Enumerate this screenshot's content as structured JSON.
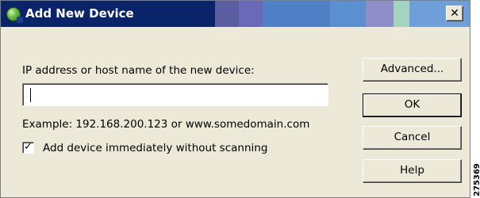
{
  "dialog": {
    "title": "Add New Device",
    "close_glyph": "✕",
    "icon": "device-globe-icon"
  },
  "form": {
    "ip_label": "IP address or host name of the new device:",
    "ip_value": "",
    "example": "Example: 192.168.200.123 or www.somedomain.com",
    "checkbox_label": "Add device immediately without scanning",
    "checkbox_checked": true
  },
  "buttons": {
    "advanced": "Advanced...",
    "ok": "OK",
    "cancel": "Cancel",
    "help": "Help"
  },
  "figure_id": "275369",
  "colors": {
    "title_bar": "#0a246a",
    "dialog_bg": "#ece9d8"
  }
}
